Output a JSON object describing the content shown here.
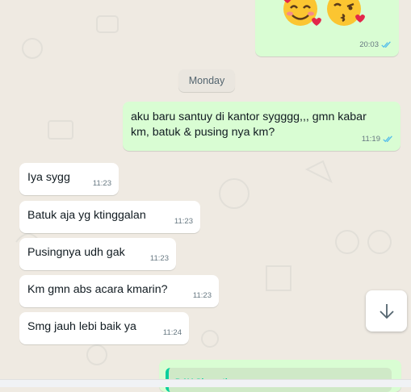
{
  "messages": [
    {
      "dir": "out",
      "time": "20:03",
      "emoji": [
        "smiling-face-with-hearts",
        "face-blowing-kiss"
      ]
    },
    {
      "date_separator": "Monday"
    },
    {
      "dir": "out",
      "line1": "aku baru santuy di kantor sygggg,,, gmn kabar",
      "line2": "km, batuk & pusing nya km?",
      "time": "11:19"
    },
    {
      "dir": "in",
      "text": "Iya sygg",
      "time": "11:23"
    },
    {
      "dir": "in",
      "text": "Batuk aja yg ktinggalan",
      "time": "11:23"
    },
    {
      "dir": "in",
      "text": "Pusingnya udh gak",
      "time": "11:23"
    },
    {
      "dir": "in",
      "text": "Km gmn abs acara kmarin?",
      "time": "11:23"
    },
    {
      "dir": "in",
      "text": "Smg jauh lebi baik ya",
      "time": "11:24"
    },
    {
      "dir": "out",
      "quoted_sender": "DAY Simpati"
    }
  ],
  "scroll_button_icon": "arrow-down-icon",
  "colors": {
    "outgoing": "#d9fdd3",
    "incoming": "#ffffff",
    "read_ticks": "#53bdeb",
    "quote_bar": "#06cf9c"
  }
}
